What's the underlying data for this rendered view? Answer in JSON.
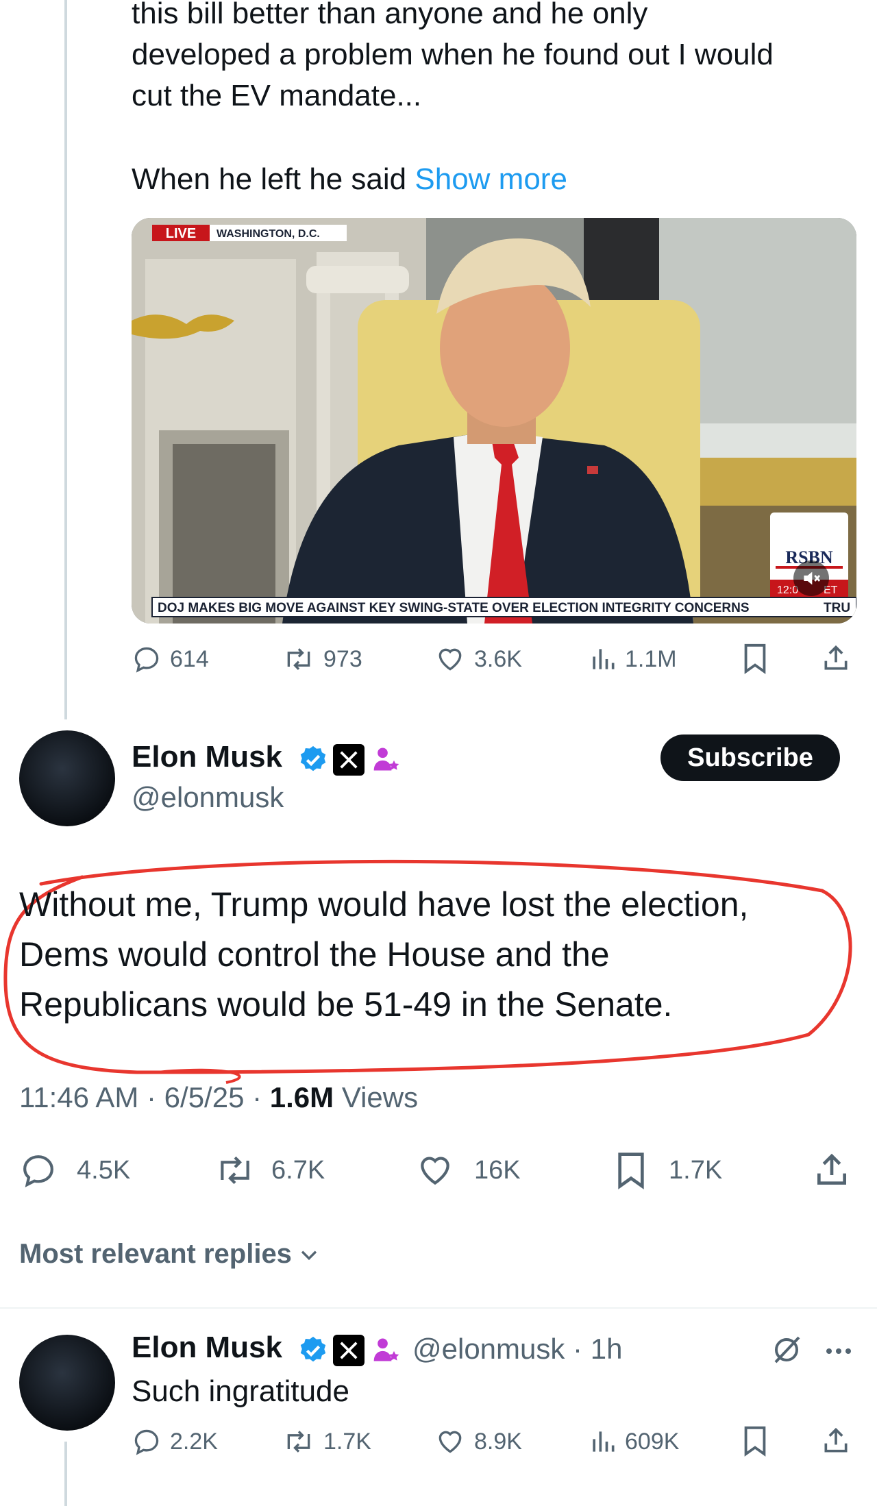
{
  "quoted_post": {
    "text_lines": [
      "this bill better than anyone and he only",
      "developed a problem when he found out I would",
      "cut the EV mandate...",
      "When he left he said"
    ],
    "show_more": "Show more",
    "video": {
      "live_label": "LIVE",
      "location": "WASHINGTON, D.C.",
      "ticker": "DOJ MAKES BIG MOVE AGAINST KEY SWING-STATE OVER ELECTION INTEGRITY CONCERNS",
      "ticker_tail": "TRU",
      "network_logo": "RSBN",
      "time_fragment": "12:0",
      "tz_fragment": "ET",
      "mute_icon": "speaker-muted-icon"
    },
    "stats": {
      "replies": "614",
      "reposts": "973",
      "likes": "3.6K",
      "views": "1.1M"
    }
  },
  "main_post": {
    "author_name": "Elon Musk",
    "handle": "@elonmusk",
    "subscribe_label": "Subscribe",
    "text_lines": [
      "Without me, Trump would have lost the election,",
      "Dems would control the House and the",
      "Republicans would be 51-49 in the Senate."
    ],
    "time": "11:46 AM",
    "date": "6/5/25",
    "views_count": "1.6M",
    "views_label": "Views",
    "stats": {
      "replies": "4.5K",
      "reposts": "6.7K",
      "likes": "16K",
      "bookmarks": "1.7K"
    },
    "colors": {
      "verified": "#1d9bf0",
      "annotation_circle": "#e8362e",
      "link": "#1d9bf0",
      "affiliate": "#c13bd6"
    }
  },
  "replies_sort": {
    "label": "Most relevant replies"
  },
  "reply": {
    "author_name": "Elon Musk",
    "handle": "@elonmusk",
    "age": "1h",
    "text": "Such ingratitude",
    "stats": {
      "replies": "2.2K",
      "reposts": "1.7K",
      "likes": "8.9K",
      "views": "609K"
    }
  }
}
